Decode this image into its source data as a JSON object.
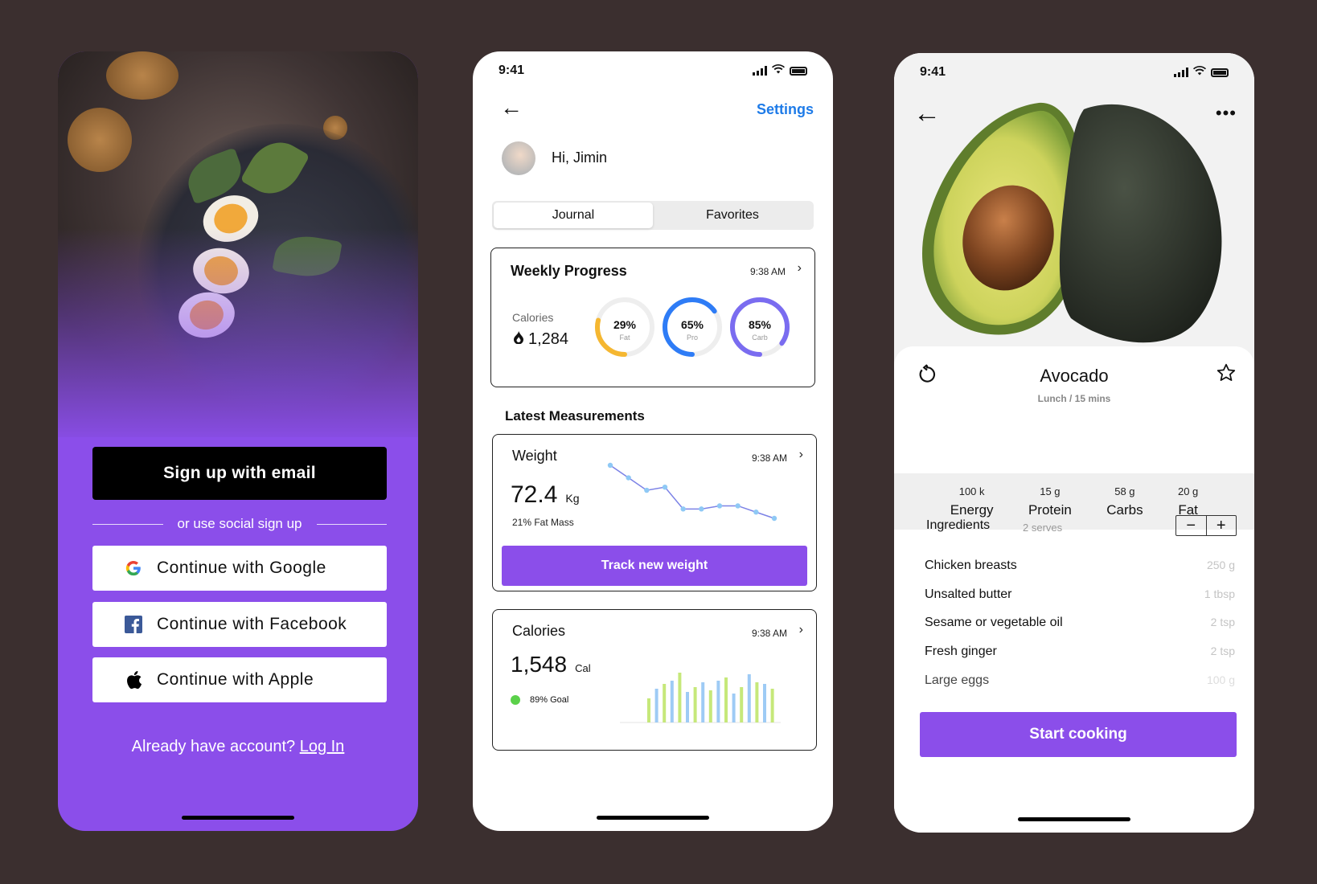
{
  "signup": {
    "email_button": "Sign up with email",
    "divider_text": "or use social sign up",
    "google_button": "Continue with Google",
    "facebook_button": "Continue with Facebook",
    "apple_button": "Continue with Apple",
    "already_text": "Already have account?",
    "login_link": "Log In"
  },
  "dashboard": {
    "status_time": "9:41",
    "settings_label": "Settings",
    "greeting": "Hi, Jimin",
    "tabs": [
      {
        "label": "Journal",
        "active": true
      },
      {
        "label": "Favorites",
        "active": false
      }
    ],
    "weekly": {
      "title": "Weekly Progress",
      "time": "9:38 AM",
      "calories_label": "Calories",
      "calories_value": "1,284",
      "rings": [
        {
          "pct": 29,
          "text": "29%",
          "label": "Fat",
          "color": "#f5b731"
        },
        {
          "pct": 65,
          "text": "65%",
          "label": "Pro",
          "color": "#2e7cf6"
        },
        {
          "pct": 85,
          "text": "85%",
          "label": "Carb",
          "color": "#7a6cf0"
        }
      ]
    },
    "latest_title": "Latest Measurements",
    "weight": {
      "title": "Weight",
      "time": "9:38 AM",
      "value": "72.4",
      "unit": "Kg",
      "sub": "21% Fat Mass",
      "button": "Track new weight"
    },
    "calories": {
      "title": "Calories",
      "time": "9:38 AM",
      "value": "1,548",
      "unit": "Cal",
      "goal": "89% Goal"
    }
  },
  "recipe": {
    "status_time": "9:41",
    "title": "Avocado",
    "subtitle": "Lunch / 15 mins",
    "nutrition": [
      {
        "value": "100 k",
        "label": "Energy"
      },
      {
        "value": "15 g",
        "label": "Protein"
      },
      {
        "value": "58 g",
        "label": "Carbs"
      },
      {
        "value": "20 g",
        "label": "Fat"
      }
    ],
    "ingredients_title": "Ingredients",
    "serves": "2 serves",
    "ingredients": [
      {
        "name": "Chicken breasts",
        "qty": "250 g"
      },
      {
        "name": "Unsalted butter",
        "qty": "1 tbsp"
      },
      {
        "name": "Sesame or vegetable oil",
        "qty": "2 tsp"
      },
      {
        "name": "Fresh ginger",
        "qty": "2 tsp"
      },
      {
        "name": "Large eggs",
        "qty": "100 g"
      }
    ],
    "start_button": "Start cooking"
  },
  "colors": {
    "background": "#3b2f2f",
    "accent_purple": "#8b4eea",
    "link_blue": "#1e7be8"
  },
  "chart_data": [
    {
      "type": "line",
      "x": [
        1,
        2,
        3,
        4,
        5,
        6,
        7,
        8,
        9
      ],
      "series": [
        {
          "values": [
            75.0,
            74.2,
            73.4,
            73.6,
            72.2,
            72.2,
            72.4,
            72.4,
            72.0,
            71.6
          ]
        }
      ],
      "title": "",
      "xlabel": "",
      "ylabel": ""
    },
    {
      "type": "bar",
      "categories": [
        "1",
        "2",
        "3",
        "4",
        "5",
        "6",
        "7",
        "8",
        "9",
        "10",
        "11",
        "12",
        "13",
        "14",
        "15",
        "16",
        "17"
      ],
      "series": [
        {
          "values": [
            30,
            42,
            48,
            52,
            62,
            38,
            44,
            50,
            40,
            52,
            56,
            36,
            44,
            60,
            50,
            48,
            42
          ]
        }
      ],
      "colors": [
        "#c6e87a",
        "#9ecbf5"
      ],
      "title": "",
      "xlabel": "",
      "ylabel": ""
    }
  ]
}
